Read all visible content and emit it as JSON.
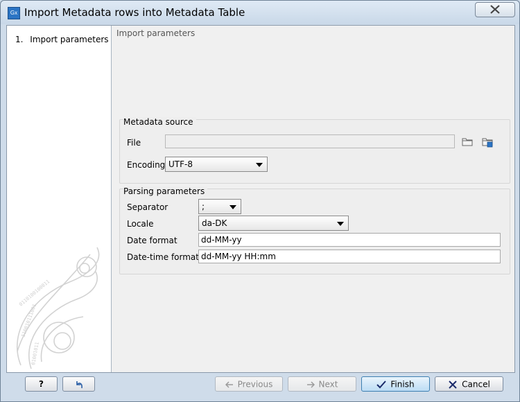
{
  "window": {
    "title": "Import Metadata rows into Metadata Table",
    "app_icon_text": "Gx"
  },
  "sidebar": {
    "steps": [
      {
        "number": "1.",
        "label": "Import parameters"
      }
    ]
  },
  "main": {
    "section_title": "Import parameters",
    "metadata_source": {
      "title": "Metadata source",
      "file_label": "File",
      "file_value": "",
      "encoding_label": "Encoding",
      "encoding_value": "UTF-8"
    },
    "parsing_parameters": {
      "title": "Parsing parameters",
      "separator_label": "Separator",
      "separator_value": ";",
      "locale_label": "Locale",
      "locale_value": "da-DK",
      "date_format_label": "Date format",
      "date_format_value": "dd-MM-yy",
      "datetime_format_label": "Date-time format",
      "datetime_format_value": "dd-MM-yy HH:mm"
    }
  },
  "footer": {
    "help_label": "?",
    "previous_label": "Previous",
    "next_label": "Next",
    "finish_label": "Finish",
    "cancel_label": "Cancel"
  },
  "colors": {
    "chrome": "#cfdcea",
    "finish_accent": "#3c7fb1",
    "cancel_icon": "#1a2a6a"
  }
}
